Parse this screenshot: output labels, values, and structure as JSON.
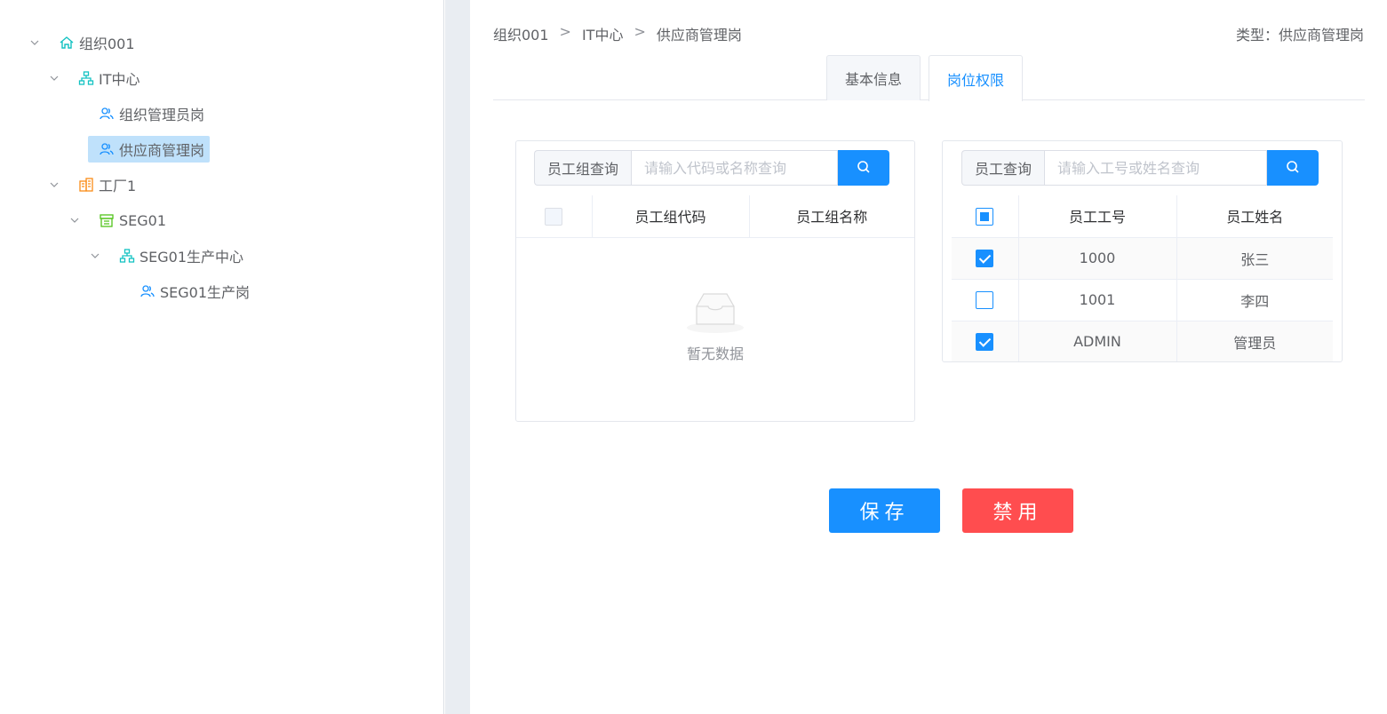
{
  "tree": {
    "nodes": [
      {
        "label": "组织001",
        "icon": "home-icon"
      },
      {
        "label": "IT中心",
        "icon": "org-chart-icon"
      },
      {
        "label": "组织管理员岗",
        "icon": "user-group-icon"
      },
      {
        "label": "供应商管理岗",
        "icon": "user-group-icon"
      },
      {
        "label": "工厂1",
        "icon": "factory-icon"
      },
      {
        "label": "SEG01",
        "icon": "store-icon"
      },
      {
        "label": "SEG01生产中心",
        "icon": "org-chart-icon"
      },
      {
        "label": "SEG01生产岗",
        "icon": "user-group-icon"
      }
    ]
  },
  "breadcrumb": [
    "组织001",
    "IT中心",
    "供应商管理岗"
  ],
  "breadcrumb_sep": ">",
  "type_label": "类型：供应商管理岗",
  "tabs": [
    {
      "label": "基本信息",
      "active": false
    },
    {
      "label": "岗位权限",
      "active": true
    }
  ],
  "group_panel": {
    "search_label": "员工组查询",
    "search_placeholder": "请输入代码或名称查询",
    "columns": [
      "员工组代码",
      "员工组名称"
    ],
    "empty_text": "暂无数据"
  },
  "employee_panel": {
    "search_label": "员工查询",
    "search_placeholder": "请输入工号或姓名查询",
    "columns": [
      "员工工号",
      "员工姓名"
    ],
    "rows": [
      {
        "id": "1000",
        "name": "张三",
        "checked": true
      },
      {
        "id": "1001",
        "name": "李四",
        "checked": false
      },
      {
        "id": "ADMIN",
        "name": "管理员",
        "checked": true
      }
    ]
  },
  "actions": {
    "save_label": "保存",
    "disable_label": "禁用"
  },
  "colors": {
    "primary": "#1890ff",
    "danger": "#ff4d4f",
    "tree_icon_teal": "#13c2c2",
    "tree_icon_blue": "#1890ff",
    "tree_icon_orange": "#fa8c16",
    "tree_icon_green": "#52c41a",
    "selected_bg": "#bfe1fb"
  }
}
